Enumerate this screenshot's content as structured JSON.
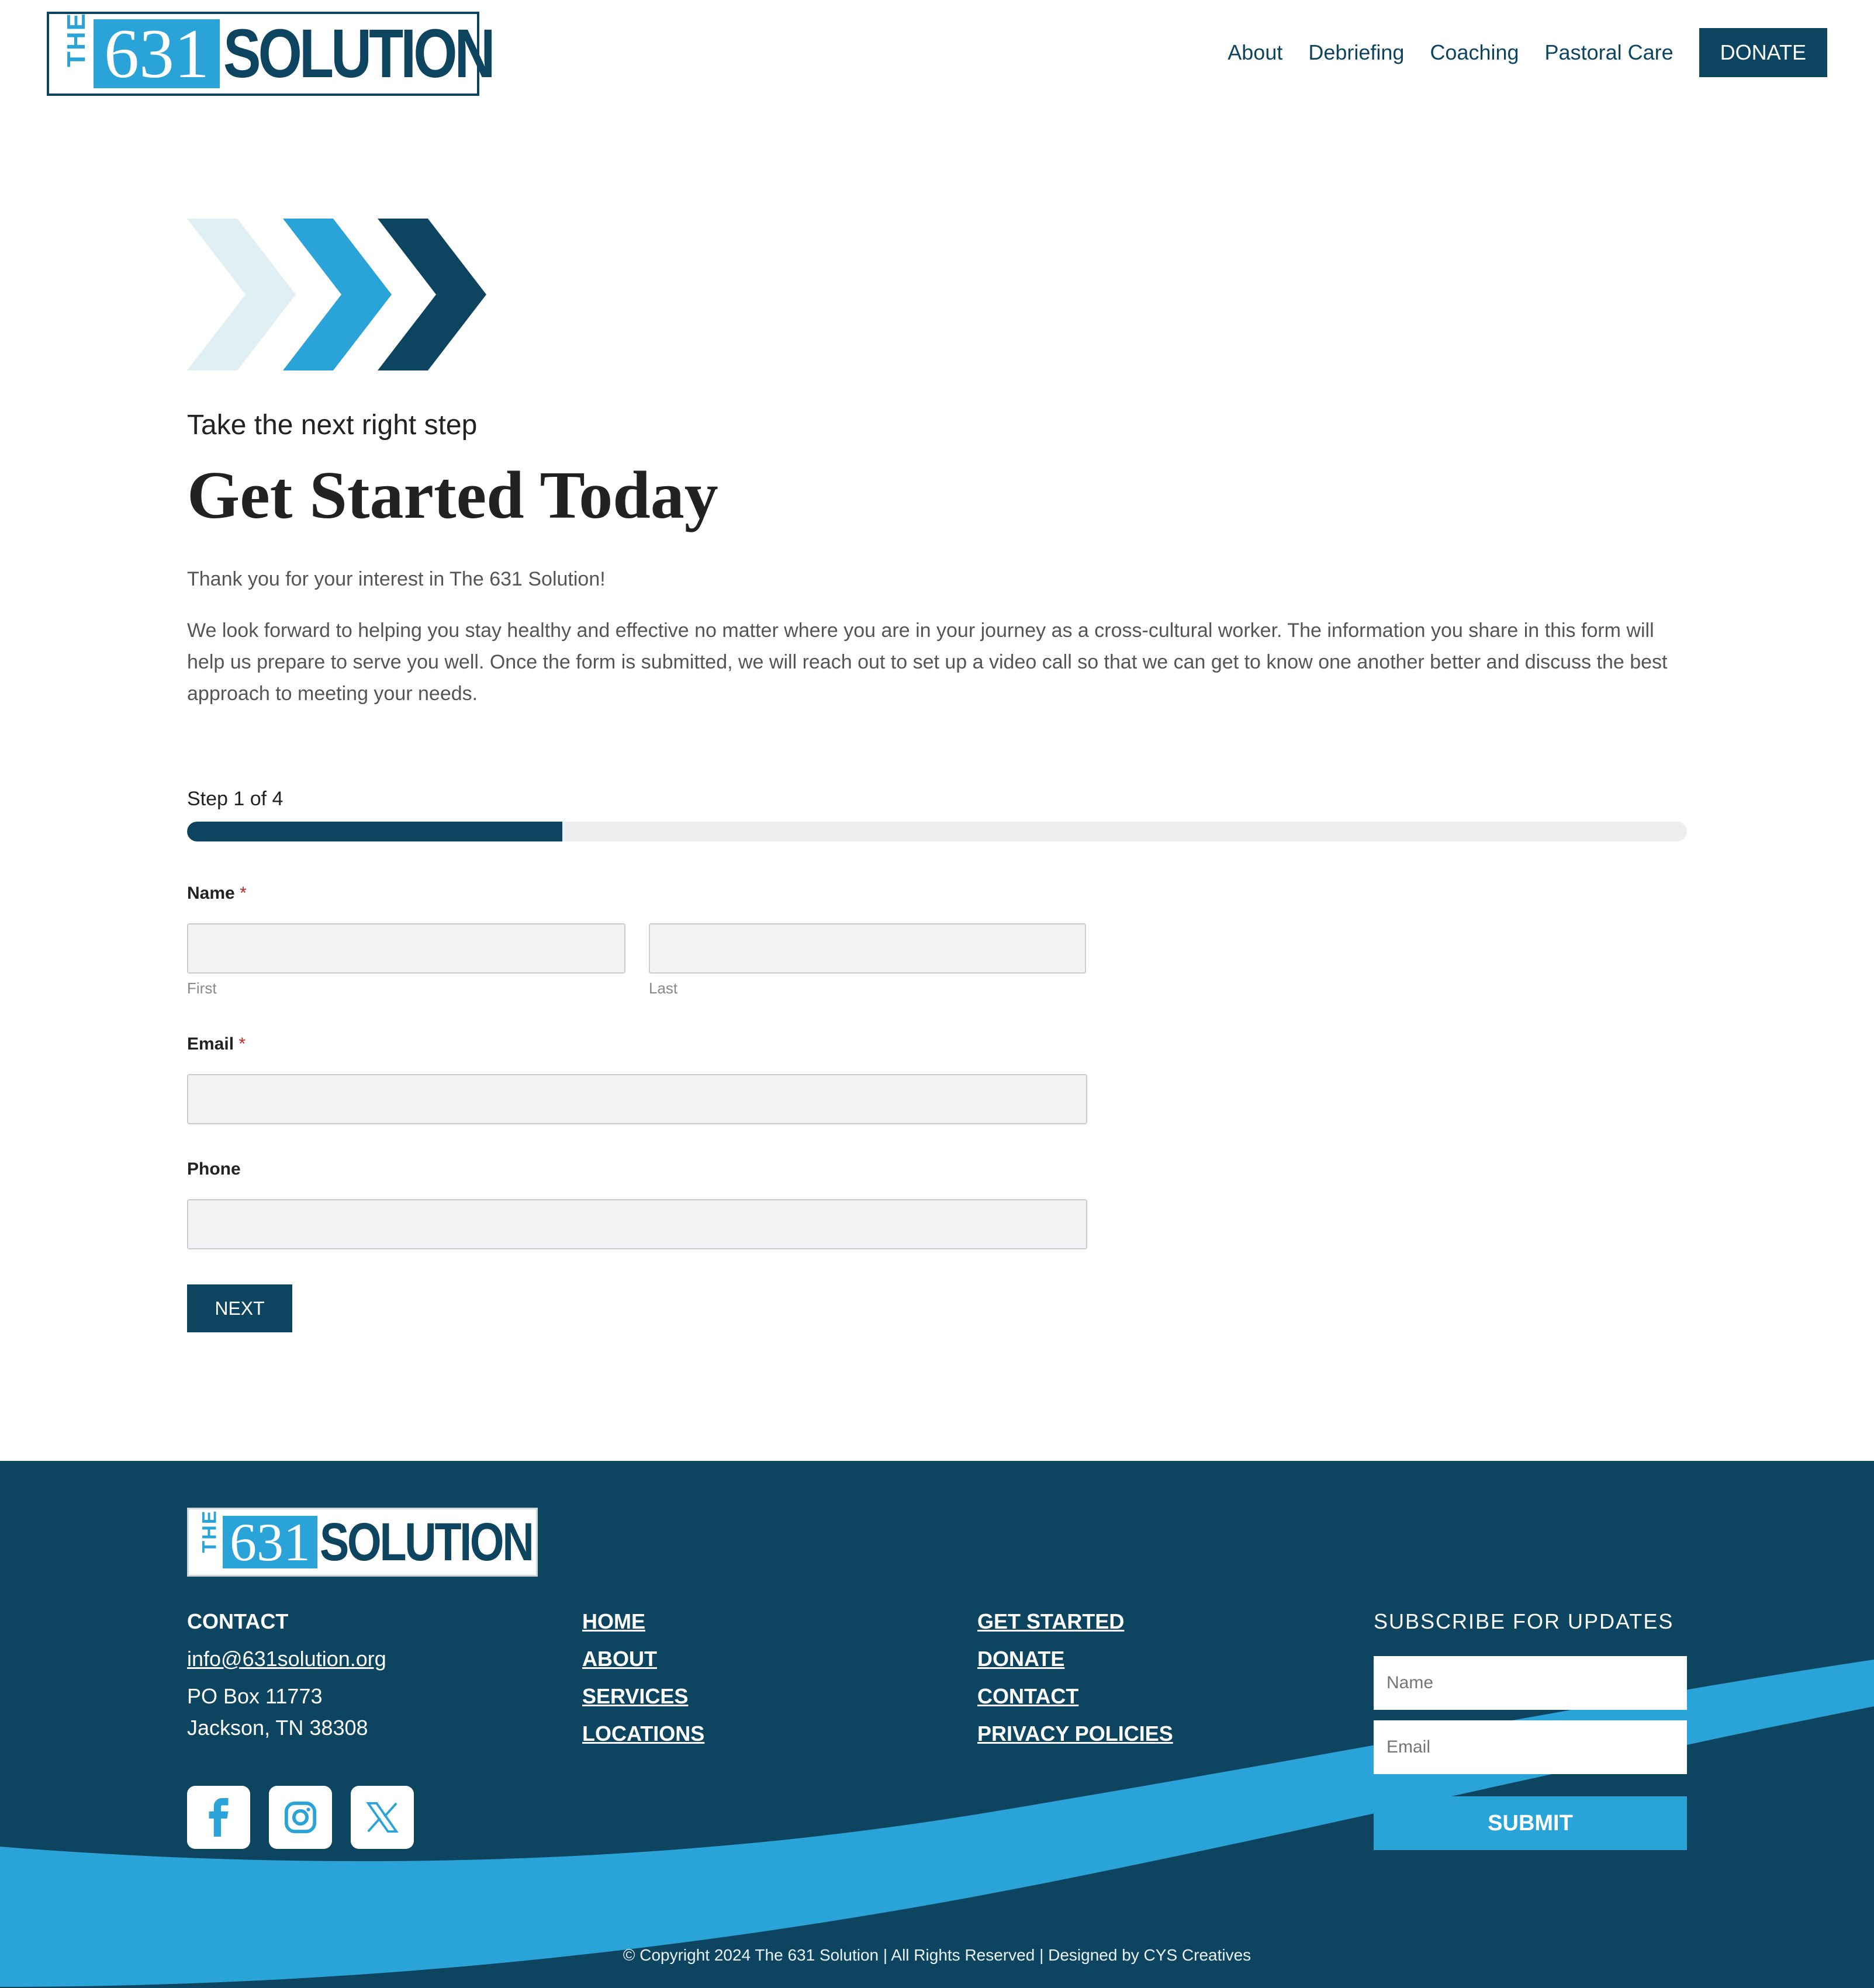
{
  "header": {
    "logo": {
      "the": "THE",
      "number": "631",
      "word": "SOLUTION"
    },
    "nav": [
      "About",
      "Debriefing",
      "Coaching",
      "Pastoral Care"
    ],
    "donate_label": "DONATE"
  },
  "hero": {
    "chevron_colors": [
      "#dfeff3",
      "#2aa3d8",
      "#0d4560"
    ],
    "subtitle": "Take the next right step",
    "title": "Get Started Today",
    "paragraphs": [
      "Thank you for your interest in The 631 Solution!",
      "We look forward to helping you stay healthy and effective no matter where you are in your journey as a cross-cultural worker. The information you share in this form will help us prepare to serve you well. Once the form is submitted, we will reach out to set up a video call so that we can get to know one another better and discuss the best approach to meeting your needs."
    ]
  },
  "form": {
    "step_label": "Step 1 of 4",
    "progress_fraction": 0.25,
    "name_label": "Name",
    "required_mark": "*",
    "first_sublabel": "First",
    "last_sublabel": "Last",
    "first_value": "",
    "last_value": "",
    "email_label": "Email",
    "email_value": "",
    "phone_label": "Phone",
    "phone_value": "",
    "next_label": "NEXT"
  },
  "footer": {
    "logo": {
      "the": "THE",
      "number": "631",
      "word": "SOLUTION"
    },
    "contact_heading": "CONTACT",
    "contact_email": "info@631solution.org",
    "address_line1": "PO Box 11773",
    "address_line2": "Jackson, TN 38308",
    "links_col1": [
      "HOME",
      "ABOUT",
      "SERVICES",
      "LOCATIONS"
    ],
    "links_col2": [
      "GET STARTED",
      "DONATE",
      "CONTACT",
      "PRIVACY POLICIES"
    ],
    "social_icons": [
      "facebook-icon",
      "instagram-icon",
      "x-icon"
    ],
    "subscribe_heading": "SUBSCRIBE FOR UPDATES",
    "subscribe_name_placeholder": "Name",
    "subscribe_email_placeholder": "Email",
    "submit_label": "SUBMIT",
    "copyright": "© Copyright 2024 The 631 Solution | All Rights Reserved | Designed by CYS Creatives"
  },
  "colors": {
    "brand_dark": "#0d4560",
    "brand_light": "#2aa3d8",
    "required": "#c62828"
  }
}
